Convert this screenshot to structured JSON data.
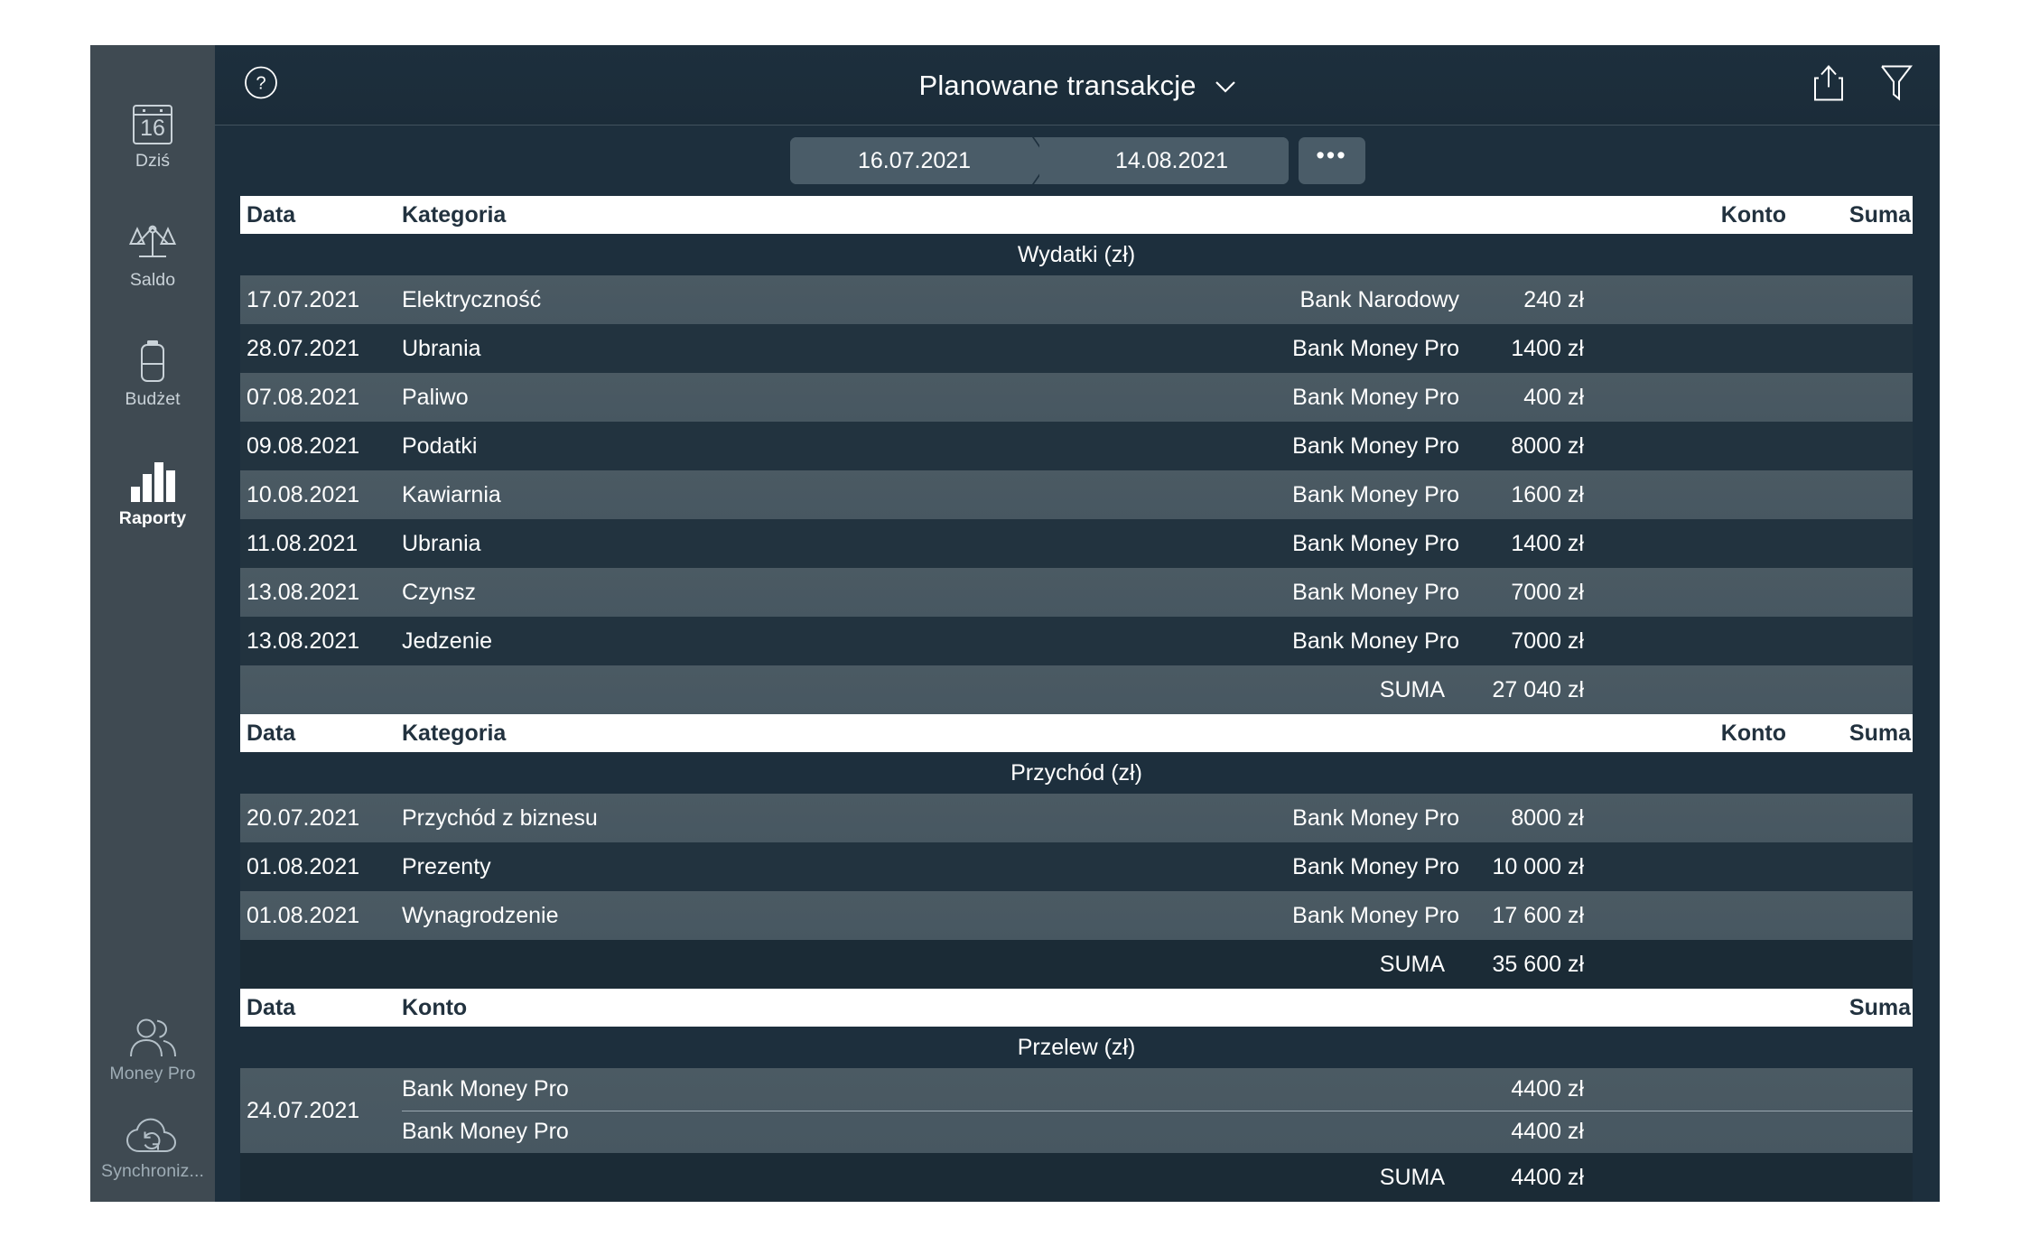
{
  "app": {
    "name": "Money Pro"
  },
  "sidebar": {
    "items": [
      {
        "id": "today",
        "label": "Dziś",
        "icon": "calendar-16-icon",
        "active": false
      },
      {
        "id": "balance",
        "label": "Saldo",
        "icon": "scales-icon",
        "active": false
      },
      {
        "id": "budget",
        "label": "Budżet",
        "icon": "battery-icon",
        "active": false
      },
      {
        "id": "reports",
        "label": "Raporty",
        "icon": "bar-chart-icon",
        "active": true
      }
    ],
    "bottom_items": [
      {
        "id": "account",
        "label": "Money Pro",
        "icon": "people-icon"
      },
      {
        "id": "sync",
        "label": "Synchroniz...",
        "icon": "cloud-sync-icon"
      }
    ],
    "calendar_day": "16"
  },
  "titlebar": {
    "help_icon": "question-circle-icon",
    "title": "Planowane transakcje",
    "caret_icon": "chevron-down-icon",
    "share_icon": "share-icon",
    "filter_icon": "filter-funnel-icon"
  },
  "daterange": {
    "from": "16.07.2021",
    "to": "14.08.2021",
    "more_label": "•••"
  },
  "columns": {
    "date": "Data",
    "category": "Kategoria",
    "account": "Konto",
    "amount": "Suma"
  },
  "sections": [
    {
      "id": "expenses",
      "title": "Wydatki (zł)",
      "header": {
        "date": "Data",
        "category": "Kategoria",
        "account": "Konto",
        "amount": "Suma"
      },
      "rows": [
        {
          "date": "17.07.2021",
          "category": "Elektryczność",
          "account": "Bank Narodowy",
          "amount": "240 zł"
        },
        {
          "date": "28.07.2021",
          "category": "Ubrania",
          "account": "Bank Money Pro",
          "amount": "1400 zł"
        },
        {
          "date": "07.08.2021",
          "category": "Paliwo",
          "account": "Bank Money Pro",
          "amount": "400 zł"
        },
        {
          "date": "09.08.2021",
          "category": "Podatki",
          "account": "Bank Money Pro",
          "amount": "8000 zł"
        },
        {
          "date": "10.08.2021",
          "category": "Kawiarnia",
          "account": "Bank Money Pro",
          "amount": "1600 zł"
        },
        {
          "date": "11.08.2021",
          "category": "Ubrania",
          "account": "Bank Money Pro",
          "amount": "1400 zł"
        },
        {
          "date": "13.08.2021",
          "category": "Czynsz",
          "account": "Bank Money Pro",
          "amount": "7000 zł"
        },
        {
          "date": "13.08.2021",
          "category": "Jedzenie",
          "account": "Bank Money Pro",
          "amount": "7000 zł"
        }
      ],
      "total_label": "SUMA",
      "total_amount": "27 040 zł"
    },
    {
      "id": "income",
      "title": "Przychód (zł)",
      "header": {
        "date": "Data",
        "category": "Kategoria",
        "account": "Konto",
        "amount": "Suma"
      },
      "rows": [
        {
          "date": "20.07.2021",
          "category": "Przychód z biznesu",
          "account": "Bank Money Pro",
          "amount": "8000 zł"
        },
        {
          "date": "01.08.2021",
          "category": "Prezenty",
          "account": "Bank Money Pro",
          "amount": "10 000 zł"
        },
        {
          "date": "01.08.2021",
          "category": "Wynagrodzenie",
          "account": "Bank Money Pro",
          "amount": "17 600 zł"
        }
      ],
      "total_label": "SUMA",
      "total_amount": "35 600 zł"
    },
    {
      "id": "transfer",
      "title": "Przelew (zł)",
      "header": {
        "date": "Data",
        "account": "Konto",
        "amount": "Suma"
      },
      "transfer": {
        "date": "24.07.2021",
        "from_account": "Bank Money Pro",
        "from_amount": "4400 zł",
        "to_account": "Bank Money Pro",
        "to_amount": "4400 zł"
      },
      "total_label": "SUMA",
      "total_amount": "4400 zł"
    }
  ],
  "colors": {
    "window_bg": "#1d2f3d",
    "sidebar_bg": "#3f4a52",
    "row_light": "#4b5a63",
    "row_dark": "#22333f",
    "header_bg": "#ffffff",
    "header_text": "#22323f",
    "pill_bg": "#4a5c68"
  }
}
